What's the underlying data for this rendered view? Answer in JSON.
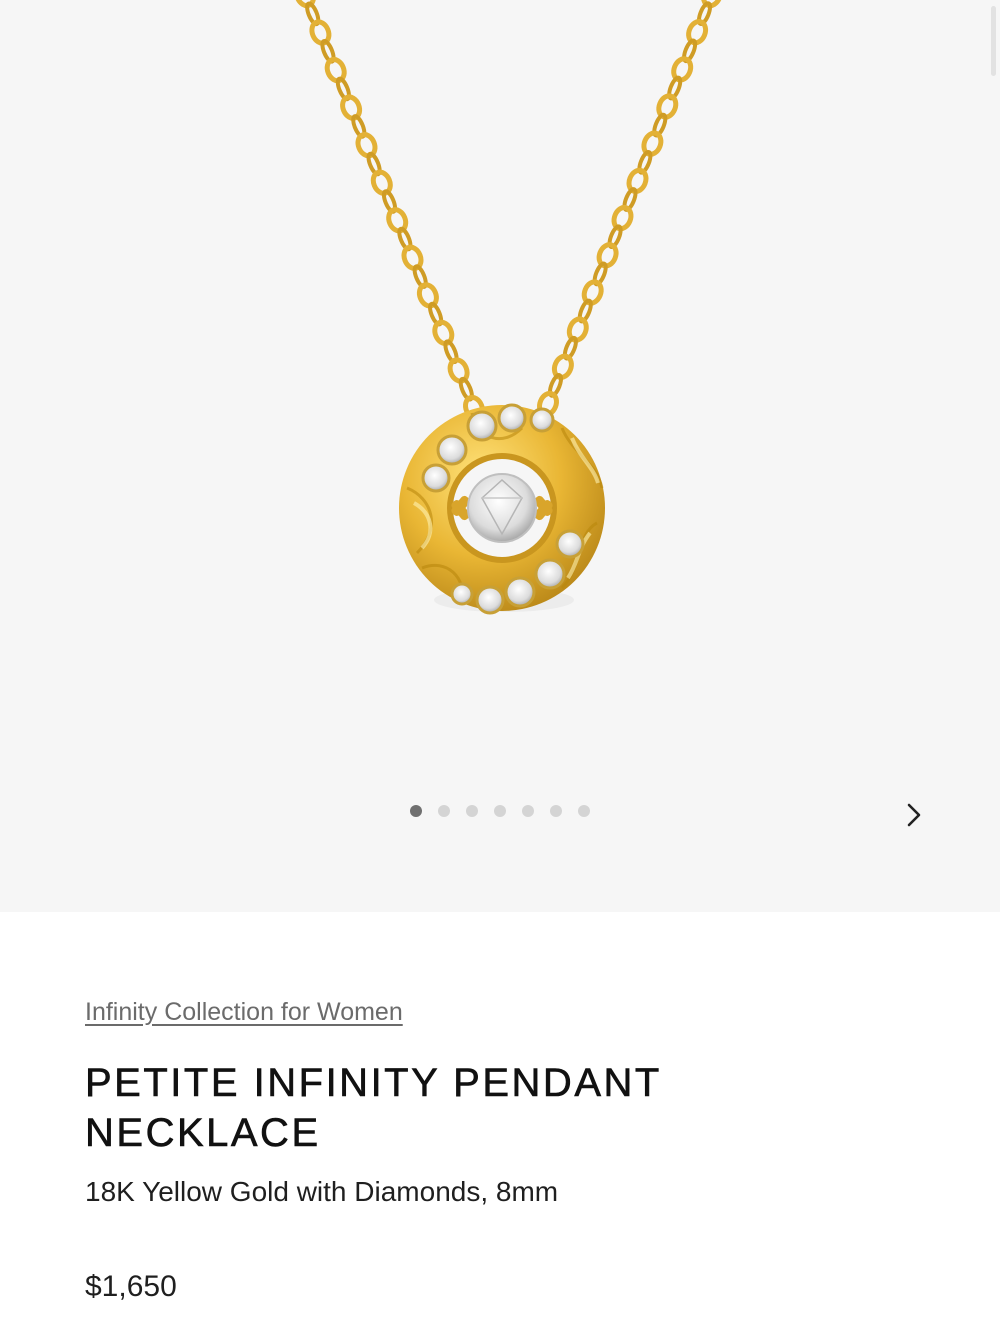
{
  "gallery": {
    "image_alt": "Petite Infinity Pendant Necklace in 18K yellow gold with diamonds",
    "slide_count": 7,
    "active_slide": 1,
    "next_icon": "chevron-right-icon"
  },
  "product": {
    "collection_link": "Infinity Collection for Women",
    "title": "PETITE INFINITY PENDANT NECKLACE",
    "subtitle": "18K Yellow Gold with Diamonds, 8mm",
    "price": "$1,650"
  },
  "colors": {
    "gold": "#e7b73a",
    "gold_dark": "#c7951f",
    "gallery_bg": "#f6f6f6"
  }
}
